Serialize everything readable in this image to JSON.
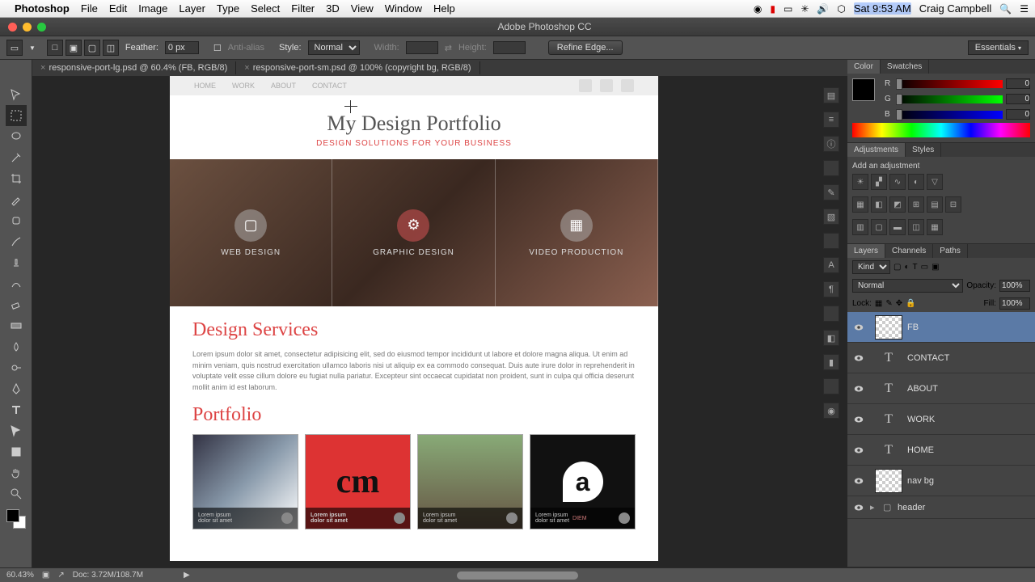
{
  "menubar": {
    "app": "Photoshop",
    "items": [
      "File",
      "Edit",
      "Image",
      "Layer",
      "Type",
      "Select",
      "Filter",
      "3D",
      "View",
      "Window",
      "Help"
    ],
    "clock": "Sat 9:53 AM",
    "user": "Craig Campbell"
  },
  "titlebar": {
    "title": "Adobe Photoshop CC"
  },
  "optbar": {
    "feather_label": "Feather:",
    "feather_value": "0 px",
    "antialias": "Anti-alias",
    "style_label": "Style:",
    "style_value": "Normal",
    "width_label": "Width:",
    "height_label": "Height:",
    "refine": "Refine Edge...",
    "workspace": "Essentials"
  },
  "tabs": [
    "responsive-port-lg.psd @ 60.4% (FB, RGB/8)",
    "responsive-port-sm.psd @ 100% (copyright bg, RGB/8)"
  ],
  "panels": {
    "color_tab1": "Color",
    "color_tab2": "Swatches",
    "r": "R",
    "g": "G",
    "b": "B",
    "val": "0",
    "adj_tab1": "Adjustments",
    "adj_tab2": "Styles",
    "adj_text": "Add an adjustment",
    "layers_tab1": "Layers",
    "layers_tab2": "Channels",
    "layers_tab3": "Paths",
    "kind": "Kind",
    "blend": "Normal",
    "opacity_label": "Opacity:",
    "opacity_val": "100%",
    "lock_label": "Lock:",
    "fill_label": "Fill:",
    "fill_val": "100%"
  },
  "layers": [
    {
      "name": "FB",
      "type": "trans",
      "sel": true
    },
    {
      "name": "CONTACT",
      "type": "T"
    },
    {
      "name": "ABOUT",
      "type": "T"
    },
    {
      "name": "WORK",
      "type": "T"
    },
    {
      "name": "HOME",
      "type": "T"
    },
    {
      "name": "nav bg",
      "type": "trans"
    },
    {
      "name": "header",
      "type": "group"
    }
  ],
  "status": {
    "zoom": "60.43%",
    "doc": "Doc: 3.72M/108.7M"
  },
  "canvas": {
    "nav": [
      "HOME",
      "WORK",
      "ABOUT",
      "CONTACT"
    ],
    "title": "My Design Portfolio",
    "subtitle": "DESIGN SOLUTIONS FOR YOUR BUSINESS",
    "features": [
      "WEB DESIGN",
      "GRAPHIC DESIGN",
      "VIDEO PRODUCTION"
    ],
    "h2a": "Design Services",
    "body": "Lorem ipsum dolor sit amet, consectetur adipisicing elit, sed do eiusmod tempor incididunt ut labore et dolore magna aliqua. Ut enim ad minim veniam, quis nostrud exercitation ullamco laboris nisi ut aliquip ex ea commodo consequat. Duis aute irure dolor in reprehenderit in voluptate velit esse cillum dolore eu fugiat nulla pariatur. Excepteur sint occaecat cupidatat non proident, sunt in culpa qui officia deserunt mollit anim id est laborum.",
    "h2b": "Portfolio",
    "caption": "Lorem ipsum\ndolor sit amet",
    "card4_extra": "DIEM"
  }
}
